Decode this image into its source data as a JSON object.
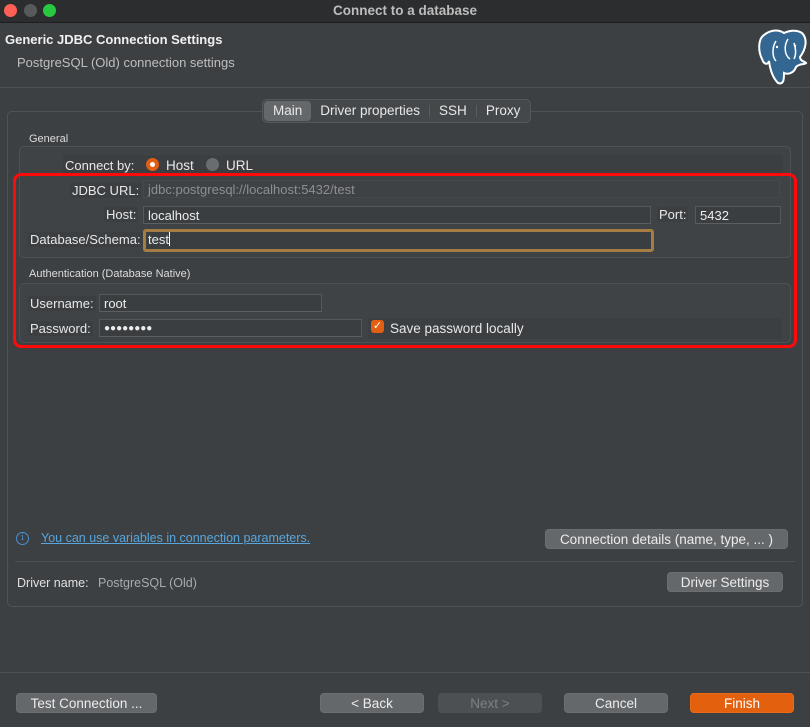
{
  "window": {
    "title": "Connect to a database"
  },
  "header": {
    "title": "Generic JDBC Connection Settings",
    "subtitle": "PostgreSQL (Old) connection settings",
    "logo_icon": "postgresql-elephant-icon"
  },
  "tabs": [
    {
      "label": "Main",
      "active": true
    },
    {
      "label": "Driver properties",
      "active": false
    },
    {
      "label": "SSH",
      "active": false
    },
    {
      "label": "Proxy",
      "active": false
    }
  ],
  "general": {
    "section_label": "General",
    "connect_by_label": "Connect by:",
    "connect_by_options": [
      {
        "label": "Host",
        "selected": true
      },
      {
        "label": "URL",
        "selected": false
      }
    ],
    "jdbc_url_label": "JDBC URL:",
    "jdbc_url_value": "jdbc:postgresql://localhost:5432/test",
    "host_label": "Host:",
    "host_value": "localhost",
    "port_label": "Port:",
    "port_value": "5432",
    "database_label": "Database/Schema:",
    "database_value": "test"
  },
  "authentication": {
    "section_label": "Authentication (Database Native)",
    "username_label": "Username:",
    "username_value": "root",
    "password_label": "Password:",
    "password_value": "●●●●●●●●",
    "save_password_label": "Save password locally",
    "save_password_checked": true
  },
  "info": {
    "link_text": "You can use variables in connection parameters.",
    "connection_details_button": "Connection details (name, type, ... )"
  },
  "driver": {
    "label": "Driver name:",
    "value": "PostgreSQL (Old)",
    "settings_button": "Driver Settings"
  },
  "footer": {
    "test_connection": "Test Connection ...",
    "back": "< Back",
    "next": "Next >",
    "cancel": "Cancel",
    "finish": "Finish"
  },
  "colors": {
    "accent": "#e3600e",
    "highlight_border": "#ff0a0a",
    "link": "#58a6db",
    "focus_border": "#a57c43"
  }
}
